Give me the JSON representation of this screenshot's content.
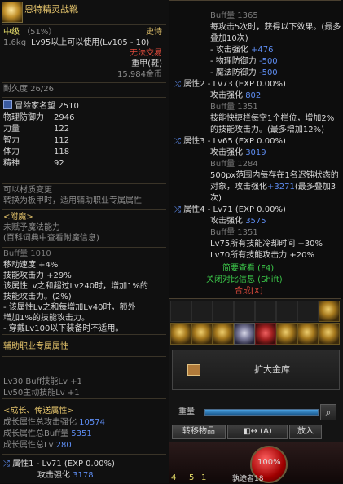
{
  "item": {
    "name": "恩特精灵战靴",
    "grade": "中级",
    "grade_pct": "（51%）",
    "rarity": "史诗",
    "weight": "1.6kg",
    "level_req": "Lv95以上可以使用(Lv105 - 10)",
    "trade": "无法交易",
    "armor_type": "重甲(鞋)",
    "price": "15,984金币",
    "durability": "耐久度 26/26",
    "adventurer_fame": "冒险家名望 2510",
    "stats": [
      {
        "label": "物理防御力",
        "value": "2946"
      },
      {
        "label": "力量",
        "value": "122"
      },
      {
        "label": "智力",
        "value": "112"
      },
      {
        "label": "体力",
        "value": "118"
      },
      {
        "label": "精神",
        "value": "92"
      }
    ],
    "material_change": "可以材质变更",
    "convert_line": "转换为板甲时，适用辅助职业专属属性",
    "enchant_header": "<附魔>",
    "enchant_none": "未赋予魔法能力",
    "enchant_hint": "(百科词典中查看附魔信息)",
    "buff_amount": "Buff量 1010",
    "effects": [
      "移动速度 +4%",
      "技能攻击力 +29%",
      "该属性Lv之和超过Lv240时，增加1%的",
      "技能攻击力。(2%)",
      "- 该属性Lv之和每增加Lv40时，额外",
      "增加1%的技能攻击力。",
      "- 穿戴Lv100以下装备时不适用。"
    ],
    "support_header": "辅助职业专属属性",
    "support_lines": [
      "Lv30 Buff技能Lv +1",
      "Lv50主动技能Lv +1"
    ],
    "growth_header": "<成长、传送属性>",
    "growth_lines": [
      {
        "label": "成长属性总攻击强化",
        "value": "10574"
      },
      {
        "label": "成长属性总Buff量",
        "value": "5351"
      },
      {
        "label": "成长属性总Lv",
        "value": "280"
      }
    ],
    "attr1_title": "属性1 - Lv71 (EXP 0.00%)",
    "attr1_attack_label": "攻击强化",
    "attr1_attack_value": "3178"
  },
  "compare": {
    "buff_top": "Buff量 1365",
    "desc_lines": [
      "每攻击5次时，获得以下效果。(最多",
      "叠加10次)"
    ],
    "list1": [
      {
        "label": "- 攻击强化",
        "value": "+476"
      },
      {
        "label": "- 物理防御力",
        "value": "-500"
      },
      {
        "label": "- 魔法防御力",
        "value": "-500"
      }
    ],
    "attr2_title": "属性2 - Lv73 (EXP 0.00%)",
    "attr2_attack": {
      "label": "攻击强化",
      "value": "802"
    },
    "attr2_buff": "Buff量 1351",
    "attr2_desc": [
      "技能快捷栏每空1个栏位，增加2%",
      "的技能攻击力。(最多增加12%)"
    ],
    "attr3_title": "属性3 - Lv65 (EXP 0.00%)",
    "attr3_attack": {
      "label": "攻击强化",
      "value": "3019"
    },
    "attr3_buff": "Buff量 1284",
    "attr3_desc": [
      "500px范围内每存在1名迟钝状态的",
      "对象，攻击强化",
      "(最多叠加3",
      "次)"
    ],
    "attr3_plus": "+3271",
    "attr4_title": "属性4 - Lv71 (EXP 0.00%)",
    "attr4_attack": {
      "label": "攻击强化",
      "value": "3575"
    },
    "attr4_buff": "Buff量 1351",
    "attr4_desc": [
      "Lv75所有技能冷却时间 +30%",
      "Lv70所有技能攻击力 +20%"
    ],
    "simple_view": "简要查看 (F4)",
    "close_compare": "关闭对比信息 (Shift)",
    "combine": "合成[X]"
  },
  "inventory": {
    "expand_label": "扩大金库",
    "weight_label": "重量",
    "transfer_label": "转移物品",
    "auto_label": "(A)",
    "put_label": "放入",
    "hp_label": "100%",
    "hud_text": "孰途者18",
    "hud_numbers": [
      "4",
      "5",
      "1"
    ]
  },
  "colors": {
    "gold": "#e1c16a",
    "blue": "#5e8df2",
    "red": "#e24b3c",
    "green": "#3cc94a"
  }
}
